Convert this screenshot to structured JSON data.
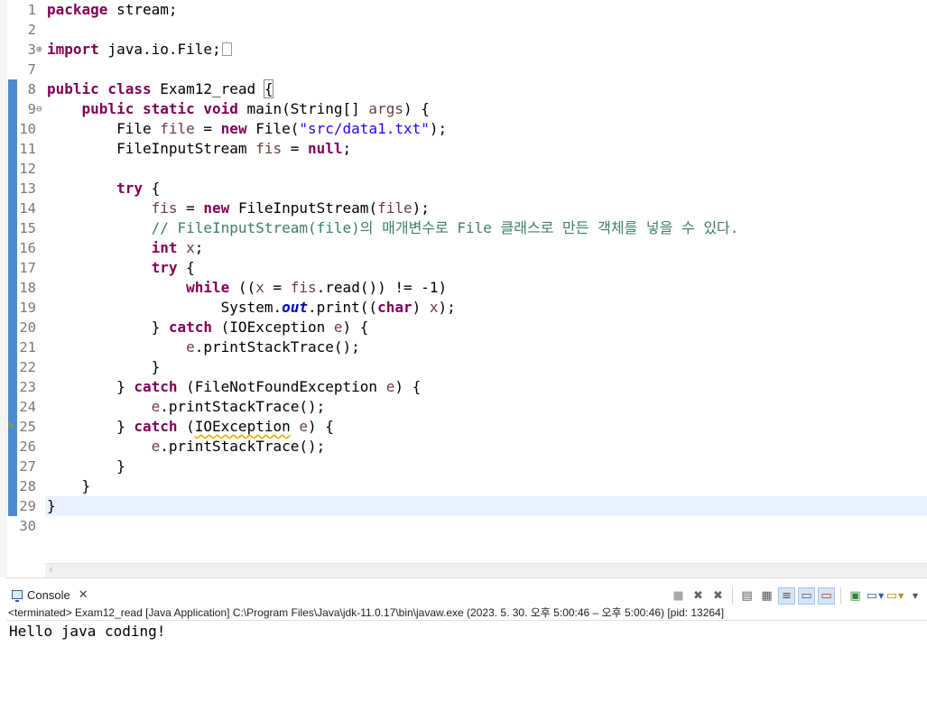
{
  "editor": {
    "lines": [
      {
        "n": "1",
        "fold": "",
        "html": "<span class=\"kw\">package</span> stream;"
      },
      {
        "n": "2",
        "fold": "",
        "html": ""
      },
      {
        "n": "3",
        "fold": "⊕",
        "html": "<span class=\"kw\">import</span> java.io.File;<span class=\"collapsed-box\"></span>"
      },
      {
        "n": "7",
        "fold": "",
        "html": ""
      },
      {
        "n": "8",
        "fold": "",
        "html": "<span class=\"kw\">public class</span> Exam12_read <span class=\"brace-box\">{</span>"
      },
      {
        "n": "9",
        "fold": "⊖",
        "html": "    <span class=\"kw\">public static void</span> main(String[] <span class=\"loc\">args</span>) {"
      },
      {
        "n": "10",
        "fold": "",
        "html": "        File <span class=\"loc\">file</span> = <span class=\"kw\">new</span> File(<span class=\"str\">\"src/data1.txt\"</span>);"
      },
      {
        "n": "11",
        "fold": "",
        "html": "        FileInputStream <span class=\"loc\">fis</span> = <span class=\"kw\">null</span>;"
      },
      {
        "n": "12",
        "fold": "",
        "html": ""
      },
      {
        "n": "13",
        "fold": "",
        "html": "        <span class=\"kw\">try</span> {"
      },
      {
        "n": "14",
        "fold": "",
        "html": "            <span class=\"loc\">fis</span> = <span class=\"kw\">new</span> FileInputStream(<span class=\"loc\">file</span>);"
      },
      {
        "n": "15",
        "fold": "",
        "html": "            <span class=\"cm\">// FileInputStream(file)의 매개변수로 File 클래스로 만든 객체를 넣을 수 있다.</span>"
      },
      {
        "n": "16",
        "fold": "",
        "html": "            <span class=\"kw\">int</span> <span class=\"loc\">x</span>;"
      },
      {
        "n": "17",
        "fold": "",
        "html": "            <span class=\"kw\">try</span> {"
      },
      {
        "n": "18",
        "fold": "",
        "html": "                <span class=\"kw\">while</span> ((<span class=\"loc\">x</span> = <span class=\"loc\">fis</span>.read()) != -1)"
      },
      {
        "n": "19",
        "fold": "",
        "html": "                    System.<span class=\"sf\">out</span>.print((<span class=\"kw\">char</span>) <span class=\"loc\">x</span>);"
      },
      {
        "n": "20",
        "fold": "",
        "html": "            } <span class=\"kw\">catch</span> (IOException <span class=\"loc\">e</span>) {"
      },
      {
        "n": "21",
        "fold": "",
        "html": "                <span class=\"loc\">e</span>.printStackTrace();"
      },
      {
        "n": "22",
        "fold": "",
        "html": "            }"
      },
      {
        "n": "23",
        "fold": "",
        "html": "        } <span class=\"kw\">catch</span> (FileNotFoundException <span class=\"loc\">e</span>) {"
      },
      {
        "n": "24",
        "fold": "",
        "html": "            <span class=\"loc\">e</span>.printStackTrace();"
      },
      {
        "n": "25",
        "fold": "",
        "html": "        } <span class=\"kw\">catch</span> (<span class=\"warn\">IOException</span> <span class=\"loc\">e</span>) {"
      },
      {
        "n": "26",
        "fold": "",
        "html": "            <span class=\"loc\">e</span>.printStackTrace();"
      },
      {
        "n": "27",
        "fold": "",
        "html": "        }"
      },
      {
        "n": "28",
        "fold": "",
        "html": "    }"
      },
      {
        "n": "29",
        "fold": "",
        "html": "}"
      },
      {
        "n": "30",
        "fold": "",
        "html": ""
      }
    ],
    "current_line": "29",
    "warning_line": "25"
  },
  "console": {
    "tab_label": "Console",
    "status": "<terminated> Exam12_read [Java Application] C:\\Program Files\\Java\\jdk-11.0.17\\bin\\javaw.exe  (2023. 5. 30. 오후 5:00:46 – 오후 5:00:46) [pid: 13264]",
    "output": "Hello java coding!"
  },
  "icons": {
    "console_tab": "console-icon",
    "close": "close-icon",
    "bulb": "lightbulb-warning-icon",
    "scroll_left": "chevron-left-icon"
  },
  "colors": {
    "keyword": "#7f0055",
    "string": "#2a00ff",
    "comment": "#3f7f5f",
    "local_var": "#6a3e3e",
    "static_field": "#0000c0",
    "current_line_bg": "#e8f2fe",
    "change_bar": "#4c8bd0"
  }
}
